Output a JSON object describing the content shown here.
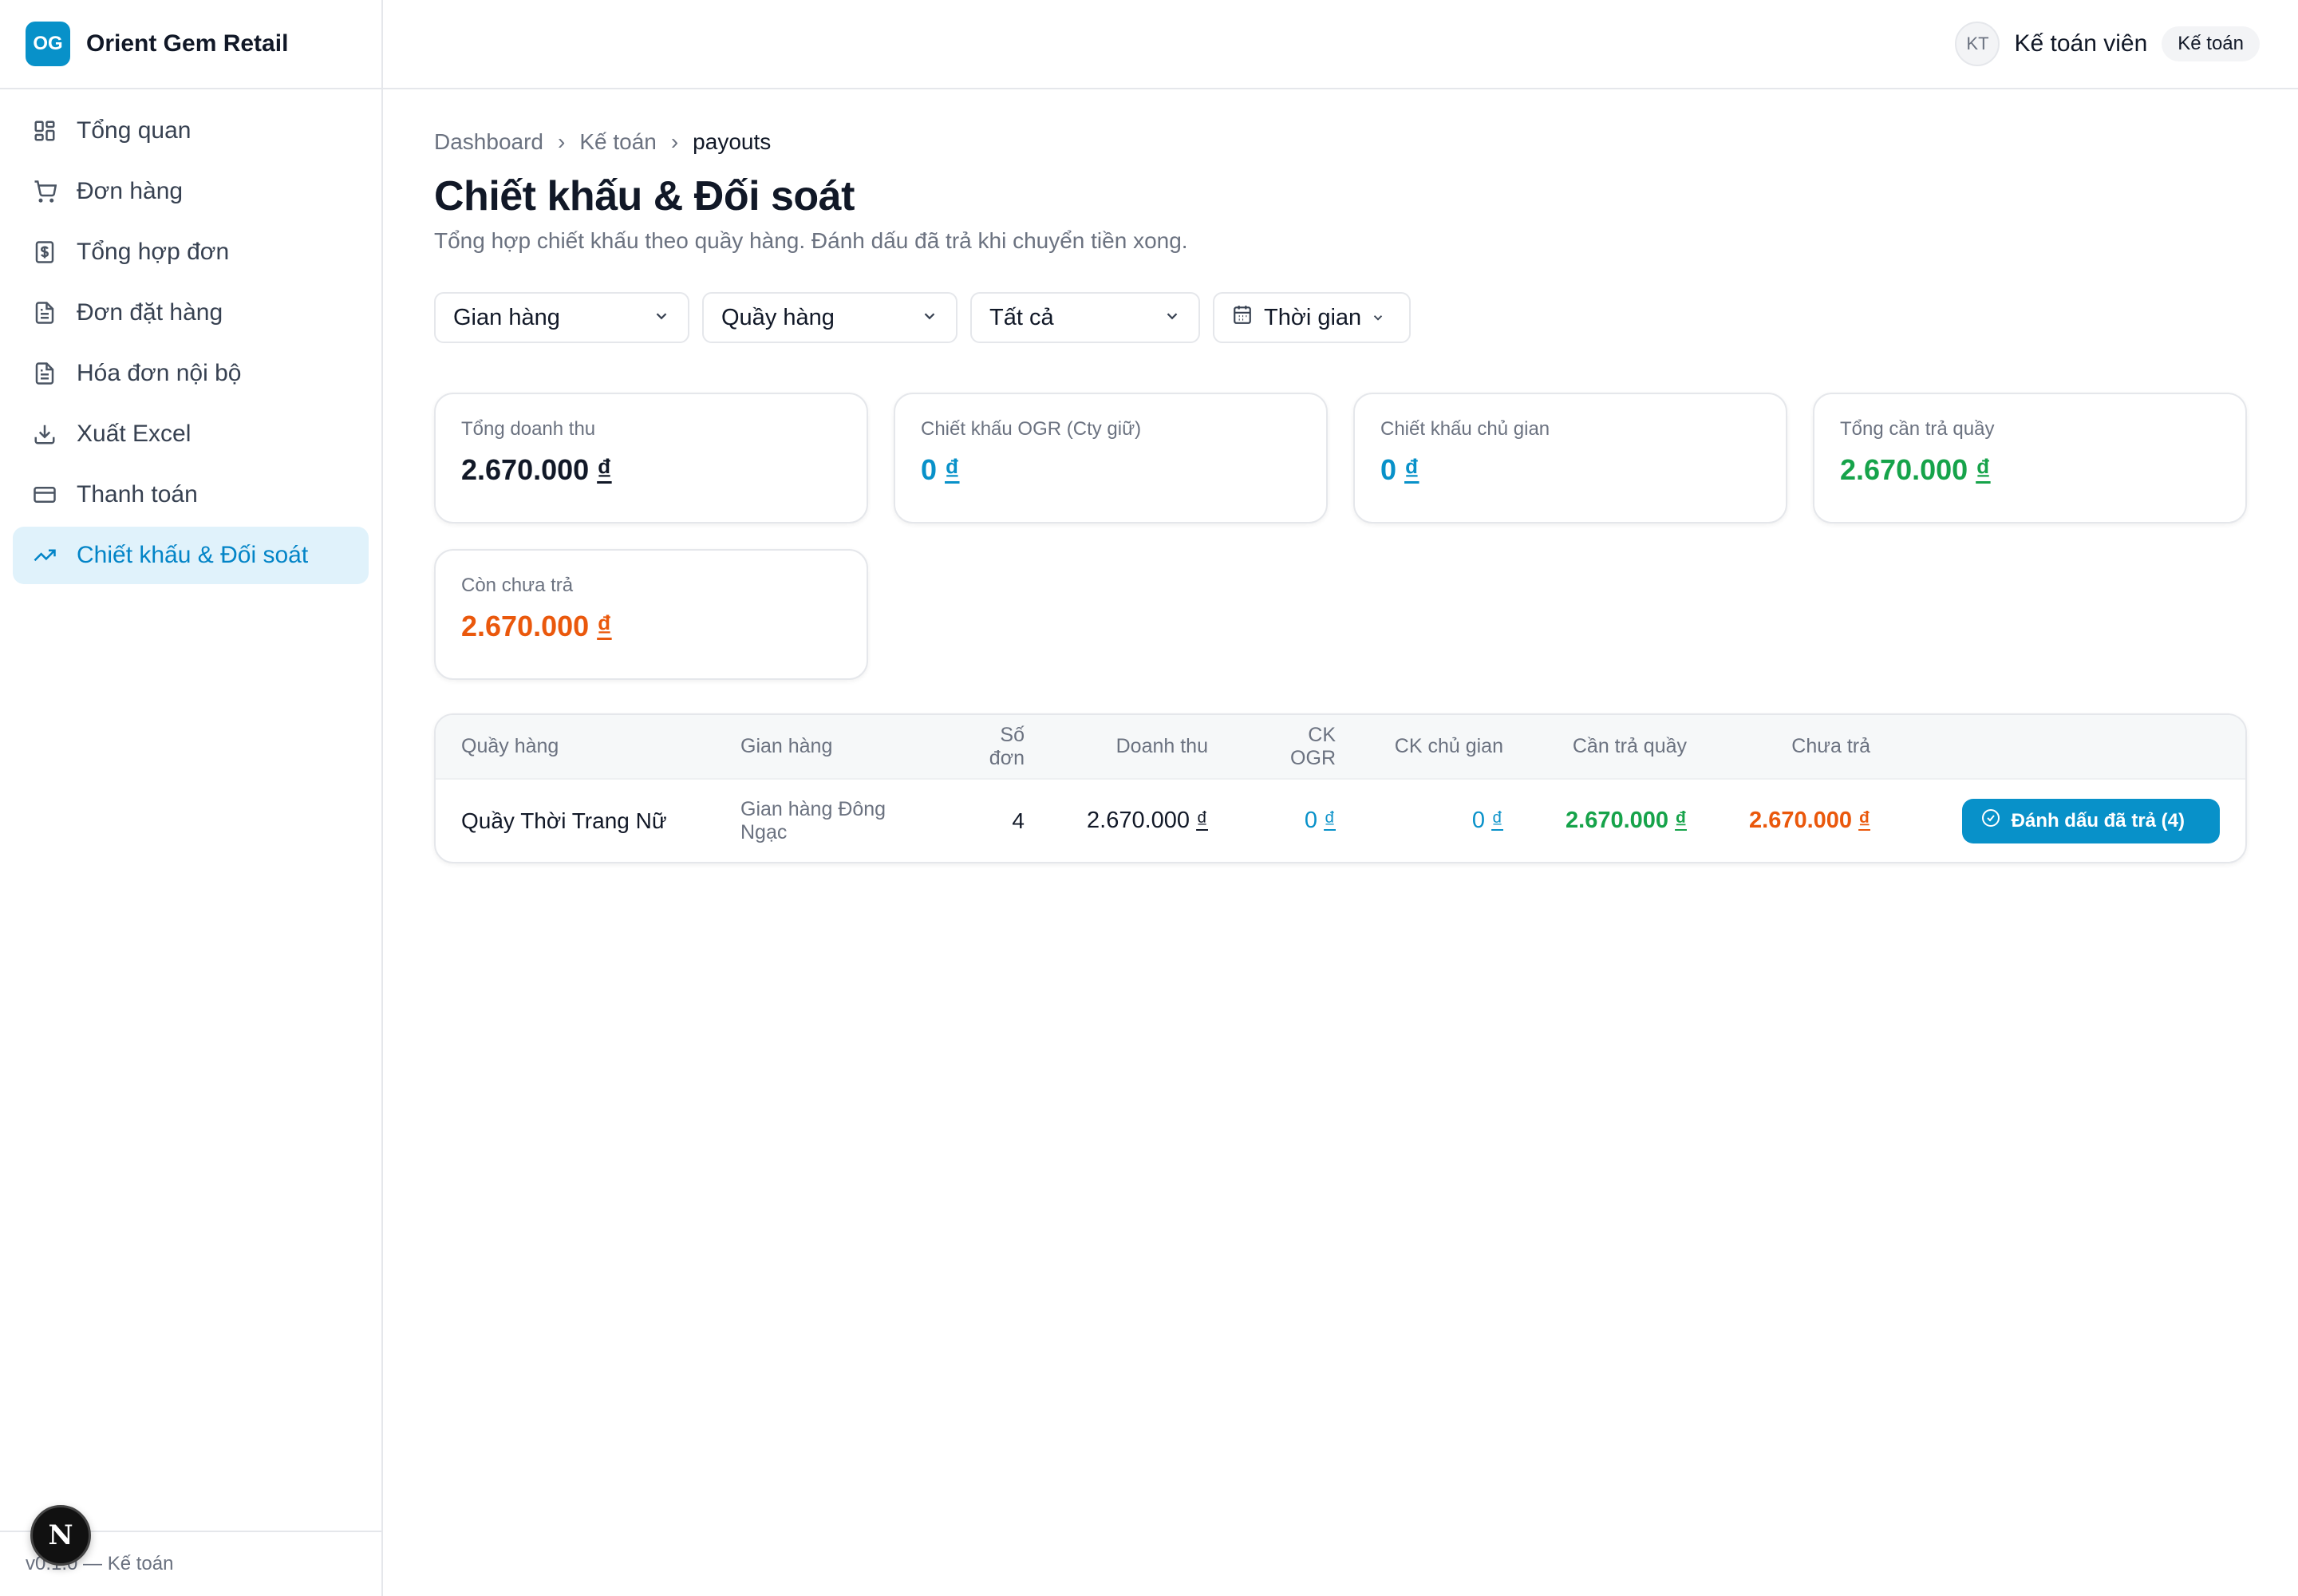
{
  "brand": {
    "logo": "OG",
    "name": "Orient Gem Retail"
  },
  "sidebar": {
    "items": [
      {
        "label": "Tổng quan",
        "icon": "dashboard-grid-icon"
      },
      {
        "label": "Đơn hàng",
        "icon": "shopping-cart-icon"
      },
      {
        "label": "Tổng hợp đơn",
        "icon": "dollar-file-icon"
      },
      {
        "label": "Đơn đặt hàng",
        "icon": "document-icon"
      },
      {
        "label": "Hóa đơn nội bộ",
        "icon": "document-icon"
      },
      {
        "label": "Xuất Excel",
        "icon": "download-icon"
      },
      {
        "label": "Thanh toán",
        "icon": "credit-card-icon"
      },
      {
        "label": "Chiết khấu & Đối soát",
        "icon": "trending-up-icon",
        "active": true
      }
    ],
    "footer": "v0.1.0 — Kế toán",
    "next_badge": "N"
  },
  "topbar": {
    "avatar": "KT",
    "user_name": "Kế toán viên",
    "role": "Kế toán"
  },
  "breadcrumb": {
    "items": [
      "Dashboard",
      "Kế toán"
    ],
    "current": "payouts"
  },
  "page": {
    "title": "Chiết khấu & Đối soát",
    "subtitle": "Tổng hợp chiết khấu theo quầy hàng. Đánh dấu đã trả khi chuyển tiền xong."
  },
  "filters": {
    "store": "Gian hàng",
    "counter": "Quầy hàng",
    "status": "Tất cả",
    "time": "Thời gian"
  },
  "summary": [
    {
      "label": "Tổng doanh thu",
      "value": "2.670.000",
      "color": "#111827"
    },
    {
      "label": "Chiết khấu OGR (Cty giữ)",
      "value": "0",
      "color": "#0891c9"
    },
    {
      "label": "Chiết khấu chủ gian",
      "value": "0",
      "color": "#0891c9"
    },
    {
      "label": "Tổng cần trả quầy",
      "value": "2.670.000",
      "color": "#16a34a"
    },
    {
      "label": "Còn chưa trả",
      "value": "2.670.000",
      "color": "#ea580c"
    }
  ],
  "currency": "₫",
  "table": {
    "headers": {
      "counter": "Quầy hàng",
      "store": "Gian hàng",
      "orders": "Số đơn",
      "revenue": "Doanh thu",
      "ck_ogr": "CK OGR",
      "ck_owner": "CK chủ gian",
      "to_pay": "Cần trả quầy",
      "unpaid": "Chưa trả"
    },
    "rows": [
      {
        "counter": "Quầy Thời Trang Nữ",
        "store": "Gian hàng Đông Ngạc",
        "orders": "4",
        "revenue": "2.670.000",
        "ck_ogr": "0",
        "ck_owner": "0",
        "to_pay": "2.670.000",
        "unpaid": "2.670.000",
        "action": "Đánh dấu đã trả (4)"
      }
    ]
  }
}
